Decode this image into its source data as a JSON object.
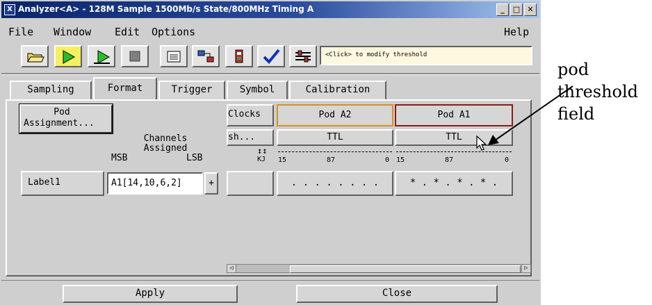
{
  "window": {
    "title": "Analyzer<A> - 128M Sample 1500Mb/s State/800MHz Timing A",
    "title_icon": "X",
    "controls": {
      "minimize": "_",
      "maximize": "□",
      "close": "✕"
    }
  },
  "menu": {
    "file": "File",
    "window": "Window",
    "edit": "Edit",
    "options": "Options",
    "help": "Help"
  },
  "toolbar": {
    "icons": [
      "open-folder-icon",
      "run-single-icon",
      "run-repetitive-icon",
      "stop-icon",
      "list-icon",
      "network-icon",
      "module-icon",
      "checkmark-icon",
      "threshold-settings-icon"
    ],
    "status_text": "<Click> to modify threshold"
  },
  "tabs": [
    "Sampling",
    "Format",
    "Trigger",
    "Symbol",
    "Calibration"
  ],
  "format": {
    "pod_assignment_line1": "Pod",
    "pod_assignment_line2": "Assignment...",
    "channels_line1": "Channels",
    "channels_line2": "Assigned",
    "msb": "MSB",
    "lsb": "LSB",
    "clocks_header": "Clocks",
    "clock_threshold": "sh...",
    "clock_bits": "KJ",
    "clock_arrows": "↕↕",
    "pods": [
      {
        "name": "Pod A2",
        "threshold": "TTL",
        "bit_high": "15",
        "bit_mid": "87",
        "bit_low": "0",
        "activity": ". . . . . . . ."
      },
      {
        "name": "Pod A1",
        "threshold": "TTL",
        "bit_high": "15",
        "bit_mid": "87",
        "bit_low": "0",
        "activity": "* . * . * . * ."
      }
    ],
    "label_name": "Label1",
    "label_channels": "A1[14,10,6,2]",
    "add_button": "+"
  },
  "buttons": {
    "apply": "Apply",
    "close": "Close"
  },
  "annotation": {
    "line1": "pod",
    "line2": "threshold",
    "line3": "field"
  },
  "colors": {
    "title_start": "#0a246a",
    "pod_a2_border": "#d89020",
    "pod_a1_border": "#8b1a1a",
    "status_field": "#fff8e0"
  }
}
